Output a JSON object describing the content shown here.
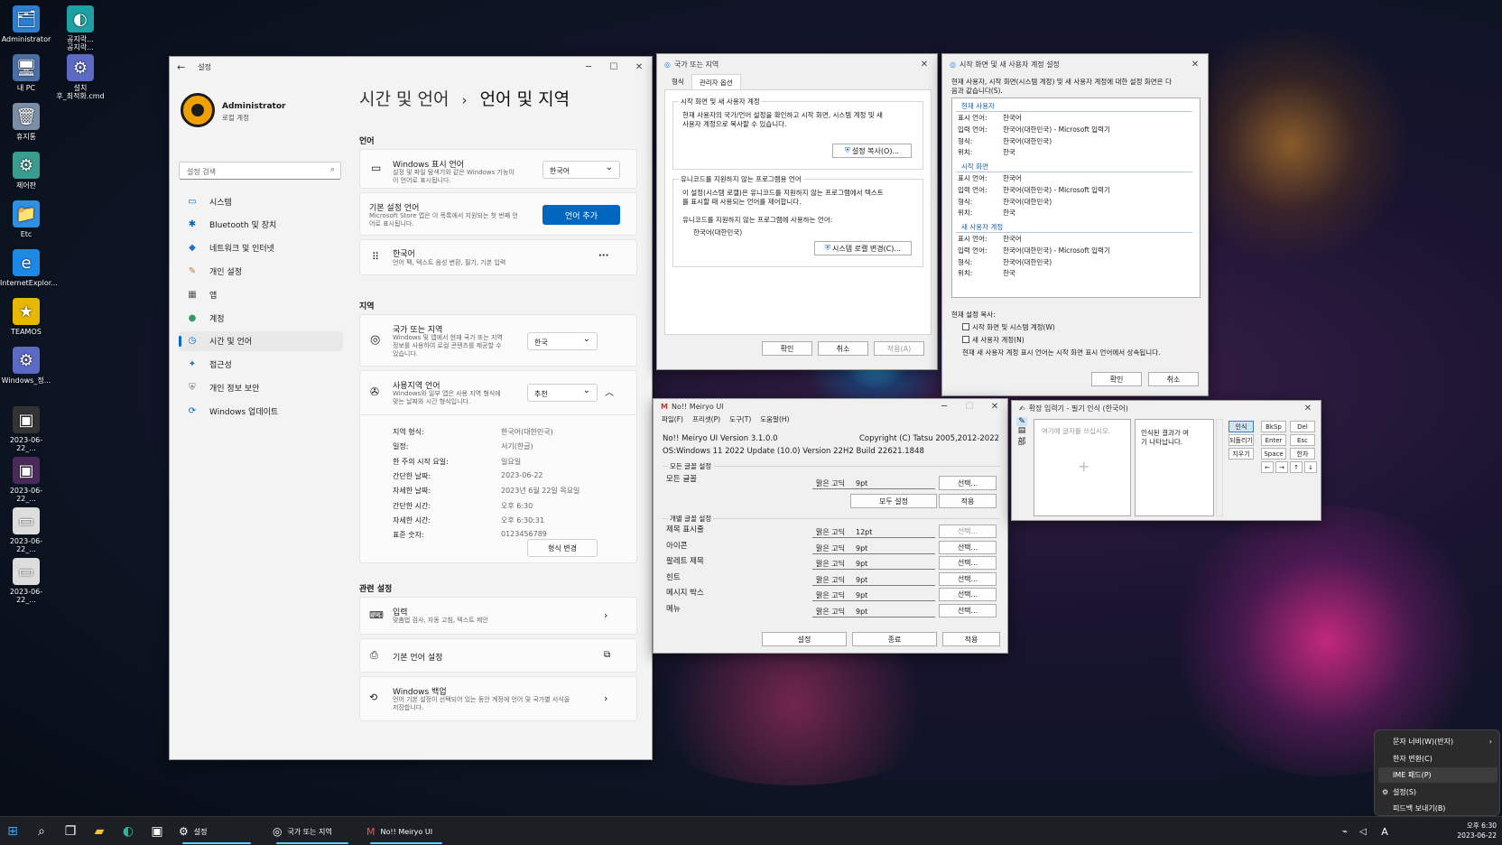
{
  "desktop": {
    "icons": [
      {
        "label": "Administrator",
        "glyph": "🗂",
        "color": "#2d7fd1"
      },
      {
        "label": "공지락...\n공지락...",
        "glyph": "◐",
        "color": "#1ca0a3"
      },
      {
        "label": "내 PC",
        "glyph": "🖥",
        "color": "#4a6fa5"
      },
      {
        "label": "설치\n후_최적화.cmd",
        "glyph": "⚙",
        "color": "#5c6ac4"
      },
      {
        "label": "휴지통",
        "glyph": "🗑",
        "color": "#7a8fa6"
      },
      {
        "label": "제어판",
        "glyph": "⚙",
        "color": "#3a9b8f"
      },
      {
        "label": "Etc",
        "glyph": "📁",
        "color": "#2f8fe0"
      },
      {
        "label": "InternetExplor...",
        "glyph": "e",
        "color": "#1e88e5"
      },
      {
        "label": "TEAMOS",
        "glyph": "★",
        "color": "#e6b800"
      },
      {
        "label": "Windows_정...",
        "glyph": "⚙",
        "color": "#5c6ac4"
      },
      {
        "label": "2023-06-22_...",
        "glyph": "▣",
        "color": "#333"
      },
      {
        "label": "2023-06-22_...",
        "glyph": "▣",
        "color": "#4a2a5a"
      },
      {
        "label": "2023-06-22_...",
        "glyph": "▭",
        "color": "#ddd"
      },
      {
        "label": "2023-06-22_...",
        "glyph": "▭",
        "color": "#ddd"
      }
    ]
  },
  "settings": {
    "window_title": "설정",
    "user_name": "Administrator",
    "user_type": "로컬 계정",
    "search_placeholder": "설정 검색",
    "nav": [
      {
        "label": "시스템",
        "icon": "▭",
        "color": "#0067c0"
      },
      {
        "label": "Bluetooth 및 장치",
        "icon": "✱",
        "color": "#0067c0"
      },
      {
        "label": "네트워크 및 인터넷",
        "icon": "◆",
        "color": "#1a73c8"
      },
      {
        "label": "개인 설정",
        "icon": "✎",
        "color": "#c47a2b"
      },
      {
        "label": "앱",
        "icon": "▦",
        "color": "#555"
      },
      {
        "label": "계정",
        "icon": "●",
        "color": "#2e9e62"
      },
      {
        "label": "시간 및 언어",
        "icon": "◷",
        "color": "#0067c0"
      },
      {
        "label": "접근성",
        "icon": "✦",
        "color": "#1a73c8"
      },
      {
        "label": "개인 정보 보안",
        "icon": "⛨",
        "color": "#777"
      },
      {
        "label": "Windows 업데이트",
        "icon": "⟳",
        "color": "#0067c0"
      }
    ],
    "breadcrumb_parent": "시간 및 언어",
    "breadcrumb_sep": "›",
    "breadcrumb_current": "언어 및 지역",
    "section_language": "언어",
    "display_lang_title": "Windows 표시 언어",
    "display_lang_desc": "설정 및 파일 탐색기와 같은 Windows 기능이\n이 언어로 표시됩니다.",
    "display_lang_value": "한국어",
    "pref_lang_title": "기본 설정 언어",
    "pref_lang_desc": "Microsoft Store 앱은 이 목록에서 지원되는 첫 번째 언\n어로 표시됩니다.",
    "add_lang_button": "언어 추가",
    "korean_title": "한국어",
    "korean_desc": "언어 팩, 텍스트 음성 변환, 필기, 기본 입력",
    "more_button": "···",
    "section_region": "지역",
    "country_title": "국가 또는 지역",
    "country_desc": "Windows 및 앱에서 현재 국가 또는 지역\n정보를 사용하여 로컬 콘텐츠를 제공할 수\n있습니다.",
    "country_value": "한국",
    "regional_title": "사용지역 언어",
    "regional_desc": "Windows와 일부 앱은 사용 지역 형식에\n맞는 날짜와 시간 형식입니다.",
    "regional_value": "추천",
    "format_rows": [
      {
        "k": "지역 형식:",
        "v": "한국어(대한민국)"
      },
      {
        "k": "일정:",
        "v": "서기(한글)"
      },
      {
        "k": "한 주의 시작 요일:",
        "v": "일요일"
      },
      {
        "k": "간단한 날짜:",
        "v": "2023-06-22"
      },
      {
        "k": "자세한 날짜:",
        "v": "2023년 6월 22일 목요일"
      },
      {
        "k": "간단한 시간:",
        "v": "오후 6:30"
      },
      {
        "k": "자세한 시간:",
        "v": "오후 6:30:31"
      },
      {
        "k": "표준 숫자:",
        "v": "0123456789"
      }
    ],
    "change_format_button": "형식 변경",
    "section_related": "관련 설정",
    "input_title": "입력",
    "input_desc": "맞춤법 검사, 자동 고침, 텍스트 제안",
    "admin_lang_title": "기본 언어 설정",
    "backup_title": "Windows 백업",
    "backup_desc": "언어 기본 설정이 선택되어 있는 동안 계정에 언어 및 국가별 서식을\n저장합니다."
  },
  "region_dialog": {
    "title": "국가 또는 지역",
    "tabs": [
      "형식",
      "관리자 옵션"
    ],
    "welcome_group": "시작 화면 및 새 사용자 계정",
    "welcome_text": "현재 사용자의 국가/언어 설정을 확인하고 시작 화면, 시스템 계정 및 새\n사용자 계정으로 복사할 수 있습니다.",
    "copy_button": "설정 복사(O)...",
    "unicode_group": "유니코드를 지원하지 않는 프로그램용 언어",
    "unicode_text": "이 설정(시스템 로캘)은 유니코드를 지원하지 않는 프로그램에서 텍스트\n를 표시할 때 사용되는 언어를 제어합니다.",
    "current_label": "유니코드를 지원하지 않는 프로그램에 사용하는 언어:",
    "current_value": "한국어(대한민국)",
    "change_locale_button": "시스템 로캘 변경(C)...",
    "ok": "확인",
    "cancel": "취소",
    "apply": "적용(A)"
  },
  "welcome_dialog": {
    "title": "시작 화면 및 새 사용자 계정 설정",
    "intro": "현재 사용자, 시작 화면(시스템 계정) 및 새 사용자 계정에 대한 설정 화면은 다\n음과 같습니다(S).",
    "sections": [
      {
        "name": "현재 사용자",
        "rows": [
          {
            "k": "표시 언어:",
            "v": "한국어"
          },
          {
            "k": "입력 언어:",
            "v": "한국어(대한민국) - Microsoft 입력기"
          },
          {
            "k": "형식:",
            "v": "한국어(대한민국)"
          },
          {
            "k": "위치:",
            "v": "한국"
          }
        ]
      },
      {
        "name": "시작 화면",
        "rows": [
          {
            "k": "표시 언어:",
            "v": "한국어"
          },
          {
            "k": "입력 언어:",
            "v": "한국어(대한민국) - Microsoft 입력기"
          },
          {
            "k": "형식:",
            "v": "한국어(대한민국)"
          },
          {
            "k": "위치:",
            "v": "한국"
          }
        ]
      },
      {
        "name": "새 사용자 계정",
        "rows": [
          {
            "k": "표시 언어:",
            "v": "한국어"
          },
          {
            "k": "입력 언어:",
            "v": "한국어(대한민국) - Microsoft 입력기"
          },
          {
            "k": "형식:",
            "v": "한국어(대한민국)"
          },
          {
            "k": "위치:",
            "v": "한국"
          }
        ]
      }
    ],
    "copy_label": "현재 설정 복사:",
    "check1": "시작 화면 및 시스템 계정(W)",
    "check2": "새 사용자 계정(N)",
    "note": "현재 새 사용자 계정 표시 언어는 시작 화면 표시 언어에서 상속됩니다.",
    "ok": "확인",
    "cancel": "취소"
  },
  "meiryo": {
    "title": "No!! Meiryo UI",
    "menu": [
      "파일(F)",
      "프리셋(P)",
      "도구(T)",
      "도움말(H)"
    ],
    "version": "No!! Meiryo UI Version 3.1.0.0",
    "copyright": "Copyright (C) Tatsu 2005,2012-2022",
    "os": "OS:Windows 11 2022 Update (10.0) Version 22H2 Build 22621.1848",
    "all_group": "모든 글꼴 설정",
    "all_label": "모든 글꼴",
    "all_font": "맑은 고딕",
    "all_size": "9pt",
    "select": "선택...",
    "set_all": "모두 설정",
    "apply": "적용",
    "indiv_group": "개별 글꼴 설정",
    "rows": [
      {
        "label": "제목 표시줄",
        "font": "맑은 고딕",
        "size": "12pt"
      },
      {
        "label": "아이콘",
        "font": "맑은 고딕",
        "size": "9pt"
      },
      {
        "label": "팔레트 제목",
        "font": "맑은 고딕",
        "size": "9pt"
      },
      {
        "label": "힌트",
        "font": "맑은 고딕",
        "size": "9pt"
      },
      {
        "label": "메시지 박스",
        "font": "맑은 고딕",
        "size": "9pt"
      },
      {
        "label": "메뉴",
        "font": "맑은 고딕",
        "size": "9pt"
      }
    ],
    "setting": "설정",
    "close": "종료"
  },
  "ime_pad": {
    "title": "확장 입력기 - 필기 인식 (한국어)",
    "write_hint": "여기에 글자를 쓰십시오.",
    "result_hint": "인식된 결과가 여\n기 나타납니다.",
    "btn_recog": "인식",
    "btn_undo": "되돌리기",
    "btn_clear": "지우기",
    "keys": [
      "BkSp",
      "Del",
      "Enter",
      "Esc",
      "Space",
      "한자"
    ],
    "arrows": [
      "←",
      "→",
      "↑",
      "↓"
    ]
  },
  "context_menu": {
    "items": [
      "문자 너비(W)(반자)",
      "한자 변환(C)",
      "IME 패드(P)",
      "설정(S)",
      "피드백 보내기(B)"
    ]
  },
  "taskbar": {
    "apps": [
      "설정",
      "국가 또는 지역",
      "No!! Meiryo UI"
    ],
    "clock_time": "오후 6:30",
    "clock_date": "2023-06-22",
    "ime_indicator": "A"
  }
}
